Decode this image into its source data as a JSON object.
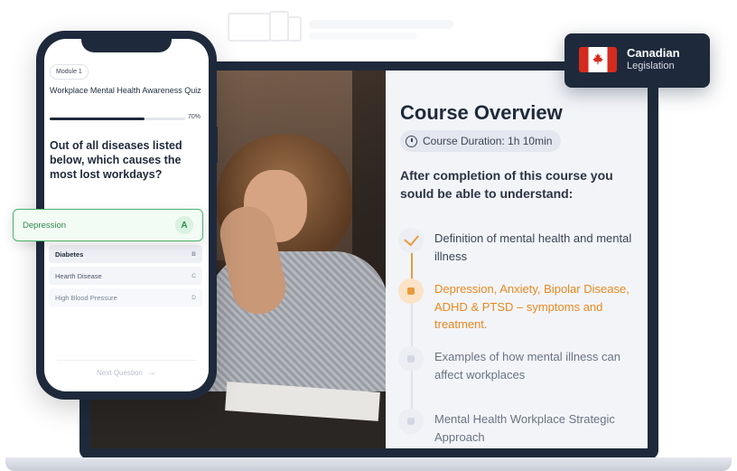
{
  "badge": {
    "title": "Canadian",
    "subtitle": "Legislation"
  },
  "quiz": {
    "module": "Module 1",
    "title": "Workplace Mental Health Awareness Quiz",
    "progress_label": "70%",
    "progress_fraction": 0.7,
    "question": "Out of all diseases listed below, which causes the most lost workdays?",
    "selected": {
      "label": "Depression",
      "key": "A"
    },
    "options": [
      {
        "label": "Diabetes",
        "key": "B"
      },
      {
        "label": "Hearth Disease",
        "key": "C"
      },
      {
        "label": "High Blood Pressure",
        "key": "D"
      }
    ],
    "next_label": "Next Question",
    "next_icon": "arrow-right-icon"
  },
  "course": {
    "title": "Course Overview",
    "duration": "Course Duration: 1h 10min",
    "subtitle": "After completion of this course you sould be able to understand:",
    "items": [
      {
        "text": "Definition of mental health and mental illness",
        "state": "done"
      },
      {
        "text": "Depression, Anxiety, Bipolar Disease, ADHD & PTSD – symptoms and treatment.",
        "state": "active"
      },
      {
        "text": "Examples of how mental illness can affect workplaces",
        "state": "upcoming"
      },
      {
        "text": "Mental Health Workplace Strategic Approach",
        "state": "upcoming"
      }
    ]
  },
  "colors": {
    "navy": "#1e2a3b",
    "accent": "#e89a3c",
    "success": "#49b36b",
    "canada_red": "#d52b1e"
  }
}
